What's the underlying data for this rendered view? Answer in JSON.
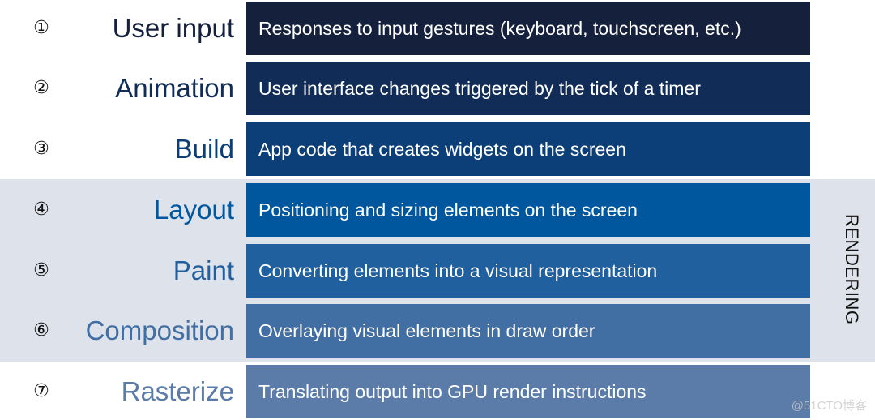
{
  "group_label": "RENDERING",
  "watermark": "@51CTO博客",
  "stages": [
    {
      "number": "①",
      "name": "User input",
      "description": "Responses to input gestures (keyboard, touchscreen, etc.)",
      "color": "#15203c"
    },
    {
      "number": "②",
      "name": "Animation",
      "description": "User interface changes triggered by the tick of a timer",
      "color": "#112c57"
    },
    {
      "number": "③",
      "name": "Build",
      "description": "App code that creates widgets on the screen",
      "color": "#0c3e77"
    },
    {
      "number": "④",
      "name": "Layout",
      "description": "Positioning and sizing elements on the screen",
      "color": "#00579e"
    },
    {
      "number": "⑤",
      "name": "Paint",
      "description": "Converting elements into a visual representation",
      "color": "#20609f"
    },
    {
      "number": "⑥",
      "name": "Composition",
      "description": "Overlaying visual elements in draw order",
      "color": "#416ea3"
    },
    {
      "number": "⑦",
      "name": "Rasterize",
      "description": "Translating output into GPU render instructions",
      "color": "#5b7ba8"
    }
  ]
}
